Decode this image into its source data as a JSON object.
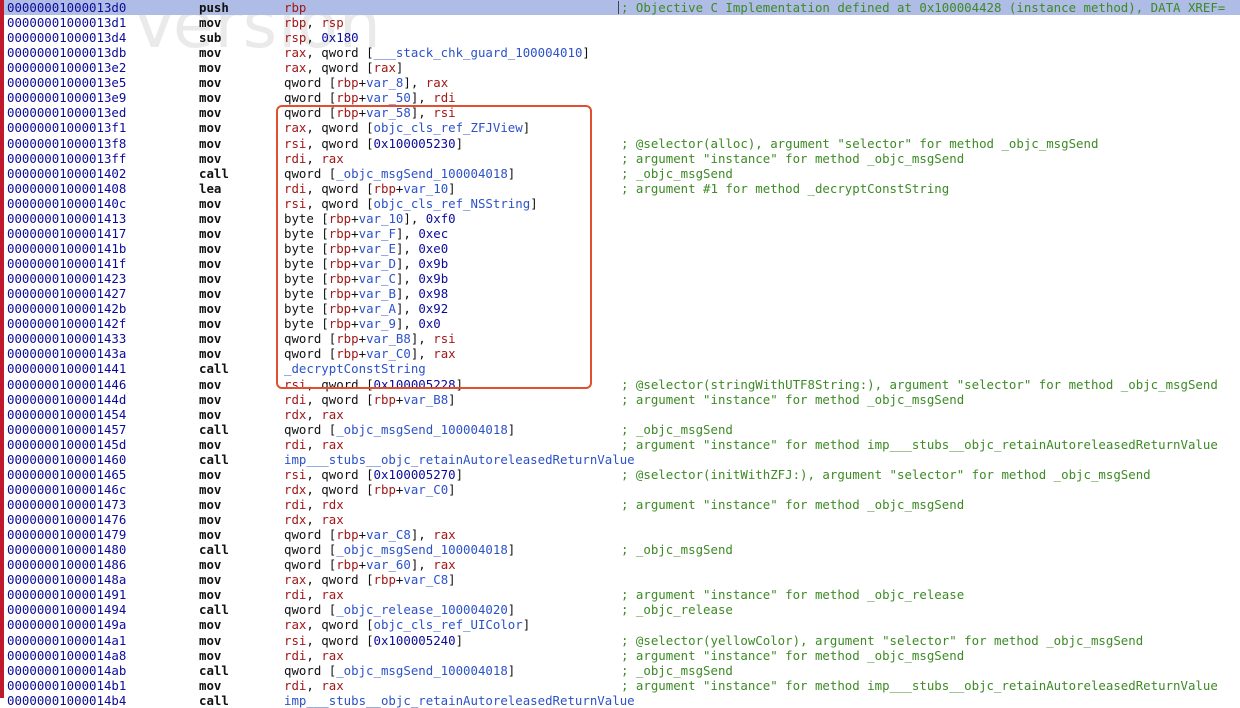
{
  "watermark": "Version",
  "highlight_color": "#e1502e",
  "rows": [
    {
      "addr": "00000001000013d0",
      "mnem": "push",
      "ops": [
        [
          "reg",
          "rbp"
        ]
      ],
      "comment": "; Objective C Implementation defined at 0x100004428 (instance method), DATA XREF=",
      "selected": true
    },
    {
      "addr": "00000001000013d1",
      "mnem": "mov",
      "ops": [
        [
          "reg",
          "rbp"
        ],
        [
          "t",
          ", "
        ],
        [
          "reg",
          "rsp"
        ]
      ]
    },
    {
      "addr": "00000001000013d4",
      "mnem": "sub",
      "ops": [
        [
          "reg",
          "rsp"
        ],
        [
          "t",
          ", "
        ],
        [
          "num",
          "0x180"
        ]
      ]
    },
    {
      "addr": "00000001000013db",
      "mnem": "mov",
      "ops": [
        [
          "reg",
          "rax"
        ],
        [
          "t",
          ", qword ["
        ],
        [
          "sym",
          "___stack_chk_guard_100004010"
        ],
        [
          "t",
          "]"
        ]
      ]
    },
    {
      "addr": "00000001000013e2",
      "mnem": "mov",
      "ops": [
        [
          "reg",
          "rax"
        ],
        [
          "t",
          ", qword ["
        ],
        [
          "reg",
          "rax"
        ],
        [
          "t",
          "]"
        ]
      ]
    },
    {
      "addr": "00000001000013e5",
      "mnem": "mov",
      "ops": [
        [
          "t",
          "qword ["
        ],
        [
          "reg",
          "rbp"
        ],
        [
          "t",
          "+"
        ],
        [
          "sym",
          "var_8"
        ],
        [
          "t",
          "], "
        ],
        [
          "reg",
          "rax"
        ]
      ]
    },
    {
      "addr": "00000001000013e9",
      "mnem": "mov",
      "ops": [
        [
          "t",
          "qword ["
        ],
        [
          "reg",
          "rbp"
        ],
        [
          "t",
          "+"
        ],
        [
          "sym",
          "var_50"
        ],
        [
          "t",
          "], "
        ],
        [
          "reg",
          "rdi"
        ]
      ]
    },
    {
      "addr": "00000001000013ed",
      "mnem": "mov",
      "ops": [
        [
          "t",
          "qword ["
        ],
        [
          "reg",
          "rbp"
        ],
        [
          "t",
          "+"
        ],
        [
          "sym",
          "var_58"
        ],
        [
          "t",
          "], "
        ],
        [
          "reg",
          "rsi"
        ]
      ]
    },
    {
      "addr": "00000001000013f1",
      "mnem": "mov",
      "ops": [
        [
          "reg",
          "rax"
        ],
        [
          "t",
          ", qword ["
        ],
        [
          "sym",
          "objc_cls_ref_ZFJView"
        ],
        [
          "t",
          "]"
        ]
      ]
    },
    {
      "addr": "00000001000013f8",
      "mnem": "mov",
      "ops": [
        [
          "reg",
          "rsi"
        ],
        [
          "t",
          ", qword ["
        ],
        [
          "num",
          "0x100005230"
        ],
        [
          "t",
          "]"
        ]
      ],
      "comment": "; @selector(alloc), argument \"selector\" for method _objc_msgSend"
    },
    {
      "addr": "00000001000013ff",
      "mnem": "mov",
      "ops": [
        [
          "reg",
          "rdi"
        ],
        [
          "t",
          ", "
        ],
        [
          "reg",
          "rax"
        ]
      ],
      "comment": "; argument \"instance\" for method _objc_msgSend"
    },
    {
      "addr": "0000000100001402",
      "mnem": "call",
      "ops": [
        [
          "t",
          "qword ["
        ],
        [
          "sym",
          "_objc_msgSend_100004018"
        ],
        [
          "t",
          "]"
        ]
      ],
      "comment": "; _objc_msgSend"
    },
    {
      "addr": "0000000100001408",
      "mnem": "lea",
      "ops": [
        [
          "reg",
          "rdi"
        ],
        [
          "t",
          ", qword ["
        ],
        [
          "reg",
          "rbp"
        ],
        [
          "t",
          "+"
        ],
        [
          "sym",
          "var_10"
        ],
        [
          "t",
          "]"
        ]
      ],
      "comment": "; argument #1 for method _decryptConstString"
    },
    {
      "addr": "000000010000140c",
      "mnem": "mov",
      "ops": [
        [
          "reg",
          "rsi"
        ],
        [
          "t",
          ", qword ["
        ],
        [
          "sym",
          "objc_cls_ref_NSString"
        ],
        [
          "t",
          "]"
        ]
      ]
    },
    {
      "addr": "0000000100001413",
      "mnem": "mov",
      "ops": [
        [
          "t",
          "byte ["
        ],
        [
          "reg",
          "rbp"
        ],
        [
          "t",
          "+"
        ],
        [
          "sym",
          "var_10"
        ],
        [
          "t",
          "], "
        ],
        [
          "num",
          "0xf0"
        ]
      ]
    },
    {
      "addr": "0000000100001417",
      "mnem": "mov",
      "ops": [
        [
          "t",
          "byte ["
        ],
        [
          "reg",
          "rbp"
        ],
        [
          "t",
          "+"
        ],
        [
          "sym",
          "var_F"
        ],
        [
          "t",
          "], "
        ],
        [
          "num",
          "0xec"
        ]
      ]
    },
    {
      "addr": "000000010000141b",
      "mnem": "mov",
      "ops": [
        [
          "t",
          "byte ["
        ],
        [
          "reg",
          "rbp"
        ],
        [
          "t",
          "+"
        ],
        [
          "sym",
          "var_E"
        ],
        [
          "t",
          "], "
        ],
        [
          "num",
          "0xe0"
        ]
      ]
    },
    {
      "addr": "000000010000141f",
      "mnem": "mov",
      "ops": [
        [
          "t",
          "byte ["
        ],
        [
          "reg",
          "rbp"
        ],
        [
          "t",
          "+"
        ],
        [
          "sym",
          "var_D"
        ],
        [
          "t",
          "], "
        ],
        [
          "num",
          "0x9b"
        ]
      ]
    },
    {
      "addr": "0000000100001423",
      "mnem": "mov",
      "ops": [
        [
          "t",
          "byte ["
        ],
        [
          "reg",
          "rbp"
        ],
        [
          "t",
          "+"
        ],
        [
          "sym",
          "var_C"
        ],
        [
          "t",
          "], "
        ],
        [
          "num",
          "0x9b"
        ]
      ]
    },
    {
      "addr": "0000000100001427",
      "mnem": "mov",
      "ops": [
        [
          "t",
          "byte ["
        ],
        [
          "reg",
          "rbp"
        ],
        [
          "t",
          "+"
        ],
        [
          "sym",
          "var_B"
        ],
        [
          "t",
          "], "
        ],
        [
          "num",
          "0x98"
        ]
      ]
    },
    {
      "addr": "000000010000142b",
      "mnem": "mov",
      "ops": [
        [
          "t",
          "byte ["
        ],
        [
          "reg",
          "rbp"
        ],
        [
          "t",
          "+"
        ],
        [
          "sym",
          "var_A"
        ],
        [
          "t",
          "], "
        ],
        [
          "num",
          "0x92"
        ]
      ]
    },
    {
      "addr": "000000010000142f",
      "mnem": "mov",
      "ops": [
        [
          "t",
          "byte ["
        ],
        [
          "reg",
          "rbp"
        ],
        [
          "t",
          "+"
        ],
        [
          "sym",
          "var_9"
        ],
        [
          "t",
          "], "
        ],
        [
          "num",
          "0x0"
        ]
      ]
    },
    {
      "addr": "0000000100001433",
      "mnem": "mov",
      "ops": [
        [
          "t",
          "qword ["
        ],
        [
          "reg",
          "rbp"
        ],
        [
          "t",
          "+"
        ],
        [
          "sym",
          "var_B8"
        ],
        [
          "t",
          "], "
        ],
        [
          "reg",
          "rsi"
        ]
      ]
    },
    {
      "addr": "000000010000143a",
      "mnem": "mov",
      "ops": [
        [
          "t",
          "qword ["
        ],
        [
          "reg",
          "rbp"
        ],
        [
          "t",
          "+"
        ],
        [
          "sym",
          "var_C0"
        ],
        [
          "t",
          "], "
        ],
        [
          "reg",
          "rax"
        ]
      ]
    },
    {
      "addr": "0000000100001441",
      "mnem": "call",
      "ops": [
        [
          "sym",
          "_decryptConstString"
        ]
      ]
    },
    {
      "addr": "0000000100001446",
      "mnem": "mov",
      "ops": [
        [
          "reg",
          "rsi"
        ],
        [
          "t",
          ", qword ["
        ],
        [
          "num",
          "0x100005228"
        ],
        [
          "t",
          "]"
        ]
      ],
      "comment": "; @selector(stringWithUTF8String:), argument \"selector\" for method _objc_msgSend"
    },
    {
      "addr": "000000010000144d",
      "mnem": "mov",
      "ops": [
        [
          "reg",
          "rdi"
        ],
        [
          "t",
          ", qword ["
        ],
        [
          "reg",
          "rbp"
        ],
        [
          "t",
          "+"
        ],
        [
          "sym",
          "var_B8"
        ],
        [
          "t",
          "]"
        ]
      ],
      "comment": "; argument \"instance\" for method _objc_msgSend"
    },
    {
      "addr": "0000000100001454",
      "mnem": "mov",
      "ops": [
        [
          "reg",
          "rdx"
        ],
        [
          "t",
          ", "
        ],
        [
          "reg",
          "rax"
        ]
      ]
    },
    {
      "addr": "0000000100001457",
      "mnem": "call",
      "ops": [
        [
          "t",
          "qword ["
        ],
        [
          "sym",
          "_objc_msgSend_100004018"
        ],
        [
          "t",
          "]"
        ]
      ],
      "comment": "; _objc_msgSend"
    },
    {
      "addr": "000000010000145d",
      "mnem": "mov",
      "ops": [
        [
          "reg",
          "rdi"
        ],
        [
          "t",
          ", "
        ],
        [
          "reg",
          "rax"
        ]
      ],
      "comment": "; argument \"instance\" for method imp___stubs__objc_retainAutoreleasedReturnValue"
    },
    {
      "addr": "0000000100001460",
      "mnem": "call",
      "ops": [
        [
          "sym",
          "imp___stubs__objc_retainAutoreleasedReturnValue"
        ]
      ]
    },
    {
      "addr": "0000000100001465",
      "mnem": "mov",
      "ops": [
        [
          "reg",
          "rsi"
        ],
        [
          "t",
          ", qword ["
        ],
        [
          "num",
          "0x100005270"
        ],
        [
          "t",
          "]"
        ]
      ],
      "comment": "; @selector(initWithZFJ:), argument \"selector\" for method _objc_msgSend"
    },
    {
      "addr": "000000010000146c",
      "mnem": "mov",
      "ops": [
        [
          "reg",
          "rdx"
        ],
        [
          "t",
          ", qword ["
        ],
        [
          "reg",
          "rbp"
        ],
        [
          "t",
          "+"
        ],
        [
          "sym",
          "var_C0"
        ],
        [
          "t",
          "]"
        ]
      ]
    },
    {
      "addr": "0000000100001473",
      "mnem": "mov",
      "ops": [
        [
          "reg",
          "rdi"
        ],
        [
          "t",
          ", "
        ],
        [
          "reg",
          "rdx"
        ]
      ],
      "comment": "; argument \"instance\" for method _objc_msgSend"
    },
    {
      "addr": "0000000100001476",
      "mnem": "mov",
      "ops": [
        [
          "reg",
          "rdx"
        ],
        [
          "t",
          ", "
        ],
        [
          "reg",
          "rax"
        ]
      ]
    },
    {
      "addr": "0000000100001479",
      "mnem": "mov",
      "ops": [
        [
          "t",
          "qword ["
        ],
        [
          "reg",
          "rbp"
        ],
        [
          "t",
          "+"
        ],
        [
          "sym",
          "var_C8"
        ],
        [
          "t",
          "], "
        ],
        [
          "reg",
          "rax"
        ]
      ]
    },
    {
      "addr": "0000000100001480",
      "mnem": "call",
      "ops": [
        [
          "t",
          "qword ["
        ],
        [
          "sym",
          "_objc_msgSend_100004018"
        ],
        [
          "t",
          "]"
        ]
      ],
      "comment": "; _objc_msgSend"
    },
    {
      "addr": "0000000100001486",
      "mnem": "mov",
      "ops": [
        [
          "t",
          "qword ["
        ],
        [
          "reg",
          "rbp"
        ],
        [
          "t",
          "+"
        ],
        [
          "sym",
          "var_60"
        ],
        [
          "t",
          "], "
        ],
        [
          "reg",
          "rax"
        ]
      ]
    },
    {
      "addr": "000000010000148a",
      "mnem": "mov",
      "ops": [
        [
          "reg",
          "rax"
        ],
        [
          "t",
          ", qword ["
        ],
        [
          "reg",
          "rbp"
        ],
        [
          "t",
          "+"
        ],
        [
          "sym",
          "var_C8"
        ],
        [
          "t",
          "]"
        ]
      ]
    },
    {
      "addr": "0000000100001491",
      "mnem": "mov",
      "ops": [
        [
          "reg",
          "rdi"
        ],
        [
          "t",
          ", "
        ],
        [
          "reg",
          "rax"
        ]
      ],
      "comment": "; argument \"instance\" for method _objc_release"
    },
    {
      "addr": "0000000100001494",
      "mnem": "call",
      "ops": [
        [
          "t",
          "qword ["
        ],
        [
          "sym",
          "_objc_release_100004020"
        ],
        [
          "t",
          "]"
        ]
      ],
      "comment": "; _objc_release"
    },
    {
      "addr": "000000010000149a",
      "mnem": "mov",
      "ops": [
        [
          "reg",
          "rax"
        ],
        [
          "t",
          ", qword ["
        ],
        [
          "sym",
          "objc_cls_ref_UIColor"
        ],
        [
          "t",
          "]"
        ]
      ]
    },
    {
      "addr": "00000001000014a1",
      "mnem": "mov",
      "ops": [
        [
          "reg",
          "rsi"
        ],
        [
          "t",
          ", qword ["
        ],
        [
          "num",
          "0x100005240"
        ],
        [
          "t",
          "]"
        ]
      ],
      "comment": "; @selector(yellowColor), argument \"selector\" for method _objc_msgSend"
    },
    {
      "addr": "00000001000014a8",
      "mnem": "mov",
      "ops": [
        [
          "reg",
          "rdi"
        ],
        [
          "t",
          ", "
        ],
        [
          "reg",
          "rax"
        ]
      ],
      "comment": "; argument \"instance\" for method _objc_msgSend"
    },
    {
      "addr": "00000001000014ab",
      "mnem": "call",
      "ops": [
        [
          "t",
          "qword ["
        ],
        [
          "sym",
          "_objc_msgSend_100004018"
        ],
        [
          "t",
          "]"
        ]
      ],
      "comment": "; _objc_msgSend"
    },
    {
      "addr": "00000001000014b1",
      "mnem": "mov",
      "ops": [
        [
          "reg",
          "rdi"
        ],
        [
          "t",
          ", "
        ],
        [
          "reg",
          "rax"
        ]
      ],
      "comment": "; argument \"instance\" for method imp___stubs__objc_retainAutoreleasedReturnValue"
    },
    {
      "addr": "00000001000014b4",
      "mnem": "call",
      "ops": [
        [
          "sym",
          "imp___stubs__objc_retainAutoreleasedReturnValue"
        ]
      ]
    }
  ]
}
